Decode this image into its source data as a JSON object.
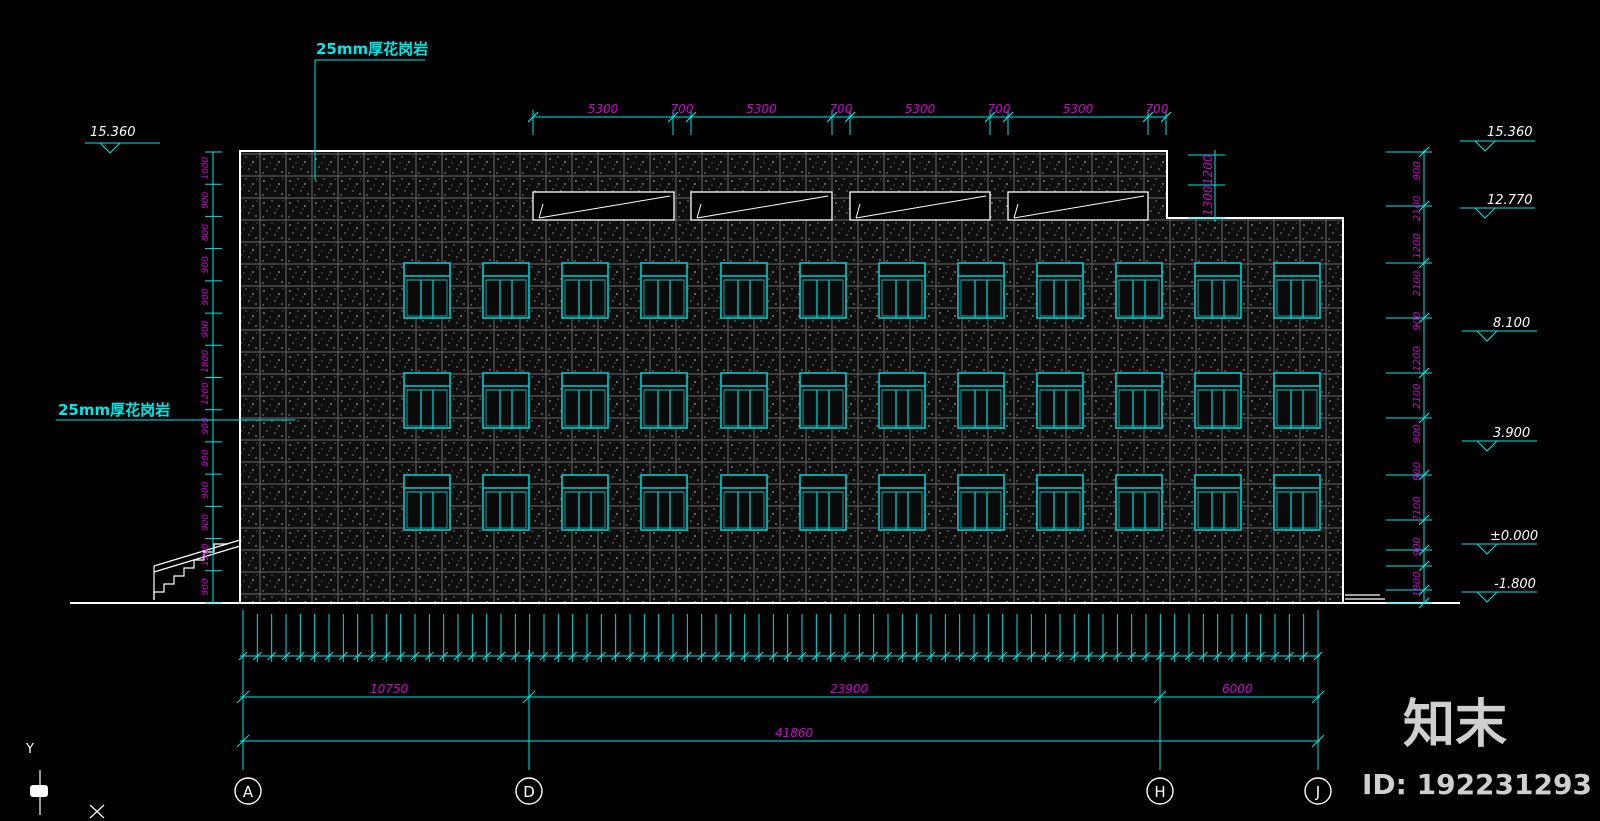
{
  "annotations": {
    "material_top": "25mm厚花岗岩",
    "material_left": "25mm厚花岗岩"
  },
  "top_dimensions": [
    "5300",
    "700",
    "5300",
    "700",
    "5300",
    "700",
    "5300",
    "700"
  ],
  "roof_step_dims": [
    "1200",
    "1300"
  ],
  "left_elevations": [
    "15.360"
  ],
  "right_elevations": [
    "15.360",
    "12.770",
    "8.100",
    "3.900",
    "±0.000",
    "-1.800"
  ],
  "left_vertical_dims": [
    "1000",
    "900",
    "800",
    "900",
    "900",
    "900",
    "1800",
    "1200",
    "900",
    "800",
    "900",
    "900",
    "1200",
    "900"
  ],
  "right_vertical_dims": [
    "900",
    "2100",
    "1200",
    "2100",
    "900",
    "1200",
    "2100",
    "900",
    "900",
    "2100",
    "900",
    "1800"
  ],
  "bottom_segment_dims": [
    "10750",
    "23900",
    "6000"
  ],
  "bottom_total_dim": "41860",
  "axis_labels": [
    "A",
    "D",
    "H",
    "J"
  ],
  "ucs": {
    "y_label": "Y",
    "x_label": "X"
  },
  "watermark": {
    "logo_text": "知末",
    "id_text": "ID: 192231293"
  },
  "colors": {
    "background": "#000000",
    "outline": "#ffffff",
    "windows": "#00cccc",
    "dims": "#00e6e6",
    "dim_text": "#d400d4"
  }
}
